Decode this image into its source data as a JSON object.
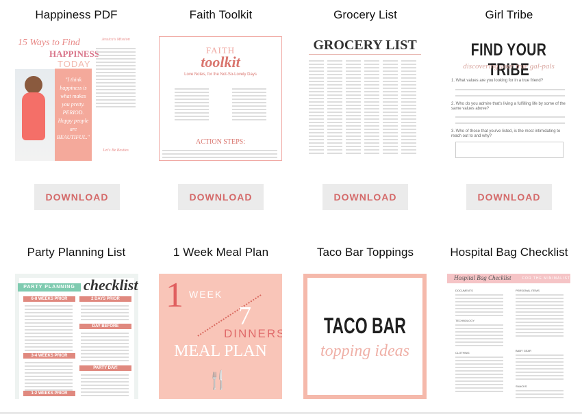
{
  "colors": {
    "accent": "#d46a6a",
    "button_bg": "#ebebeb",
    "peach": "#f6b6a8"
  },
  "items": [
    {
      "title": "Happiness PDF",
      "button": "DOWNLOAD",
      "thumb": {
        "heading1": "15 Ways to Find",
        "heading2": "HAPPINESS",
        "heading3": "TODAY",
        "quote": "\"I think happiness is what makes you pretty. PERIOD. Happy people are BEAUTIFUL.\"",
        "side_title": "Jessica's Mission",
        "side2_title": "Let's Be Besties"
      }
    },
    {
      "title": "Faith Toolkit",
      "button": "DOWNLOAD",
      "thumb": {
        "heading1": "FAITH",
        "heading2": "toolkit",
        "subtitle": "Love Notes, for the Not-So-Lovely Days",
        "section": "ACTION STEPS:"
      }
    },
    {
      "title": "Grocery List",
      "button": "DOWNLOAD",
      "thumb": {
        "heading": "GROCERY LIST"
      }
    },
    {
      "title": "Girl Tribe",
      "button": "DOWNLOAD",
      "thumb": {
        "heading": "FIND YOUR TRIBE",
        "subtitle": "discovering your true gal-pals",
        "q1": "1. What values are you looking for in a true friend?",
        "q2": "2. Who do you admire that's living a fulfilling life by some of the same values above?",
        "q3": "3. Who of those that you've listed, is the most intimidating to reach out to and why?"
      }
    },
    {
      "title": "Party Planning List",
      "thumb": {
        "heading1": "PARTY PLANNING",
        "heading2": "checklist",
        "sec1": "6-8 WEEKS PRIOR",
        "sec2": "3-4 WEEKS PRIOR",
        "sec3": "1-2 WEEKS PRIOR",
        "sec4": "2 DAYS PRIOR",
        "sec5": "DAY BEFORE",
        "sec6": "PARTY DAY!"
      }
    },
    {
      "title": "1 Week Meal Plan",
      "thumb": {
        "one": "1",
        "week": "WEEK",
        "seven": "7",
        "dinners": "DINNERS",
        "meal": "MEAL PLAN"
      }
    },
    {
      "title": "Taco Bar Toppings",
      "thumb": {
        "heading": "TACO BAR",
        "subtitle": "topping ideas"
      }
    },
    {
      "title": "Hospital Bag Checklist",
      "thumb": {
        "heading": "Hospital Bag Checklist",
        "tag": "FOR THE MINIMALIST",
        "sec1": "DOCUMENTS",
        "sec2": "TECHNOLOGY",
        "sec3": "CLOTHING",
        "sec4": "PERSONAL ITEMS",
        "sec5": "BABY GEAR",
        "sec6": "SNACKS"
      }
    }
  ]
}
